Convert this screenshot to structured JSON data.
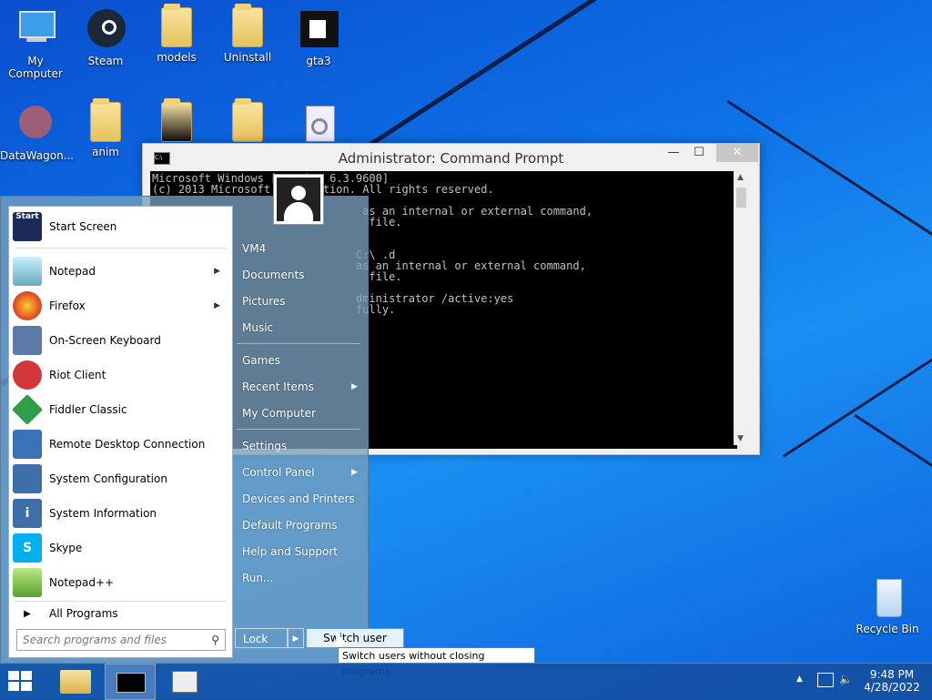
{
  "desktop": {
    "icons": [
      {
        "label": "My Computer"
      },
      {
        "label": "Steam"
      },
      {
        "label": "models"
      },
      {
        "label": "Uninstall"
      },
      {
        "label": "gta3"
      },
      {
        "label": "DataWagon..."
      },
      {
        "label": "anim"
      },
      {
        "label": ""
      },
      {
        "label": ""
      },
      {
        "label": ""
      }
    ],
    "recycle_bin": "Recycle Bin"
  },
  "cmd": {
    "title": "Administrator: Command Prompt",
    "lines": [
      "Microsoft Windows [Version 6.3.9600]",
      "(c) 2013 Microsoft Corporation. All rights reserved.",
      "",
      "                                as an internal or external command,",
      "                                 file.",
      "",
      "",
      "                               C:\\ .d",
      "                               as an internal or external command,",
      "                                 file.",
      "",
      "                               dministrator /active:yes",
      "                               fully."
    ]
  },
  "start_menu": {
    "left_items": [
      {
        "label": "Start Screen"
      },
      {
        "label": "Notepad",
        "arrow": true
      },
      {
        "label": "Firefox",
        "arrow": true
      },
      {
        "label": "On-Screen Keyboard"
      },
      {
        "label": "Riot Client"
      },
      {
        "label": "Fiddler Classic"
      },
      {
        "label": "Remote Desktop Connection"
      },
      {
        "label": "System Configuration"
      },
      {
        "label": "System Information"
      },
      {
        "label": "Skype"
      },
      {
        "label": "Notepad++"
      }
    ],
    "all_programs": "All Programs",
    "search_placeholder": "Search programs and files",
    "right_items": [
      {
        "label": "VM4"
      },
      {
        "label": "Documents"
      },
      {
        "label": "Pictures"
      },
      {
        "label": "Music"
      },
      {
        "label": "Games"
      },
      {
        "label": "Recent Items",
        "arrow": true
      },
      {
        "label": "My Computer"
      },
      {
        "label": "Settings"
      },
      {
        "label": "Control Panel",
        "arrow": true
      },
      {
        "label": "Devices and Printers"
      },
      {
        "label": "Default Programs"
      },
      {
        "label": "Help and Support"
      },
      {
        "label": "Run..."
      }
    ],
    "lock_label": "Lock",
    "switch_user_label": "Switch user",
    "tooltip": "Switch users without closing programs."
  },
  "taskbar": {
    "time": "9:48 PM",
    "date": "4/28/2022"
  }
}
